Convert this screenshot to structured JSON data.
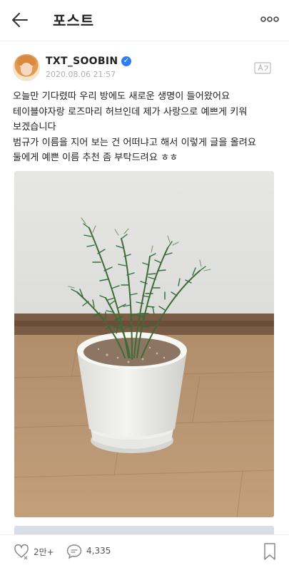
{
  "header": {
    "title": "포스트",
    "back_icon": "arrow-left-icon",
    "more_icon": "more-horizontal-icon"
  },
  "post": {
    "author": "TXT_SOOBIN",
    "verified_icon": "verified-check-icon",
    "timestamp": "2020.08.06 21:57",
    "translate_icon": "translate-icon",
    "lines": [
      "오늘만 기다렸따 우리 방에도 새로운 생명이 들어왔어요",
      "테이블야자랑 로즈마리 허브인데 제가 사랑으로 예쁘게 키워",
      "보겠습니다",
      "범규가 이름을 지어 보는 건 어떠냐고 해서 이렇게 글을 올려요",
      "둘에게 예쁜 이름 추천 좀 부탁드려요 ㅎㅎ"
    ],
    "photo": "potted-rosemary-photo"
  },
  "footer": {
    "likes": "2만+",
    "comments": "4,335",
    "like_icon": "heart-icon",
    "comment_icon": "comment-icon",
    "bookmark_icon": "bookmark-icon"
  },
  "colors": {
    "verified": "#2f7cf6",
    "text": "#222222",
    "muted": "#b0b0b0"
  }
}
